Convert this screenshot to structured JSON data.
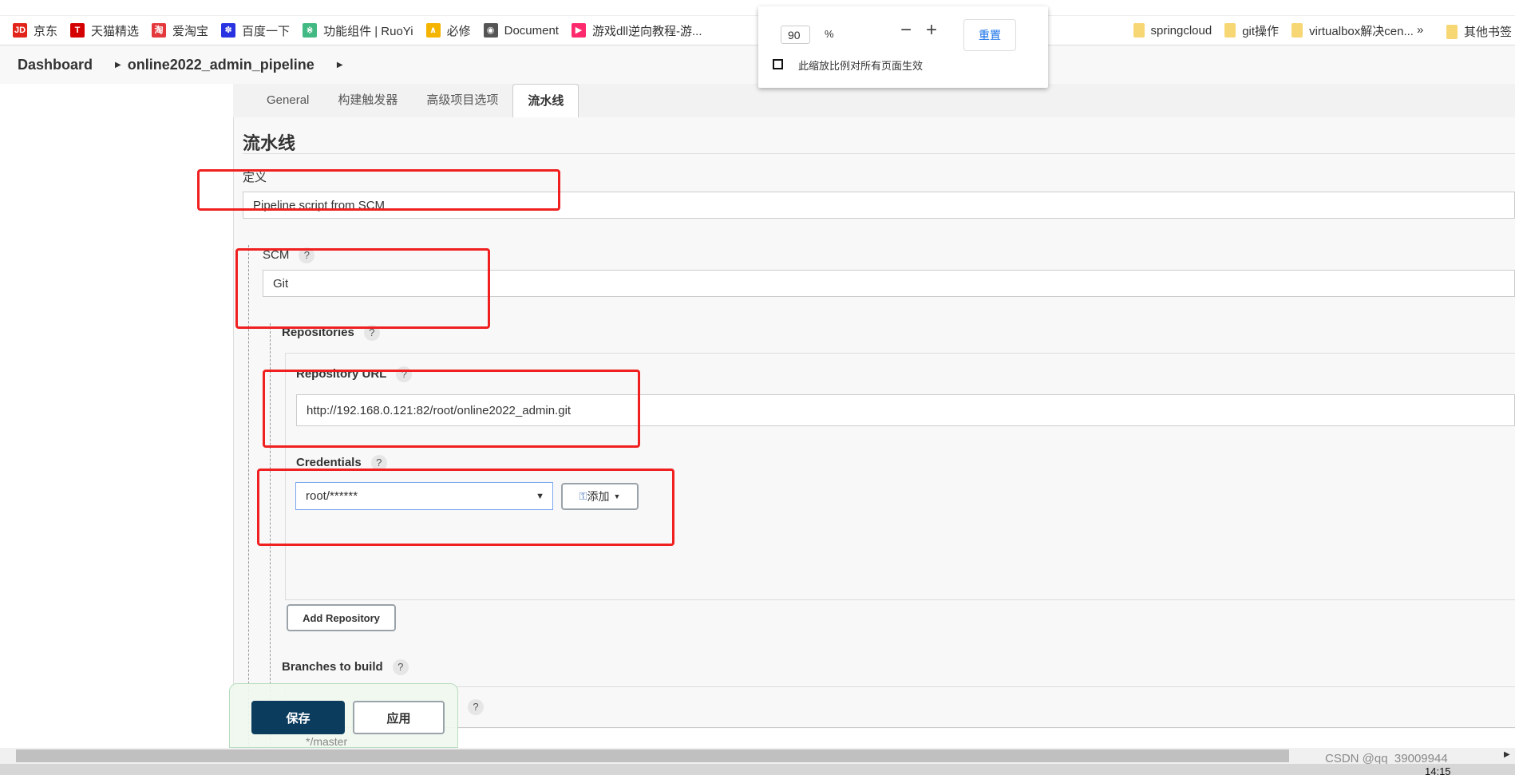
{
  "bookmarks": [
    {
      "label": "京东",
      "icon": "jd-icon",
      "color": "#e1251b",
      "glyph": "JD"
    },
    {
      "label": "天猫精选",
      "icon": "tmall-icon",
      "color": "#d40000",
      "glyph": "T"
    },
    {
      "label": "爱淘宝",
      "icon": "taobao-icon",
      "color": "#e4393c",
      "glyph": "淘"
    },
    {
      "label": "百度一下",
      "icon": "baidu-icon",
      "color": "#2932e1",
      "glyph": "✽"
    },
    {
      "label": "功能组件 | RuoYi",
      "icon": "ruoyi-icon",
      "color": "#42b983",
      "glyph": "⋇"
    },
    {
      "label": "必修",
      "icon": "bixiu-icon",
      "color": "#f5b400",
      "glyph": "∧"
    },
    {
      "label": "Document",
      "icon": "globe-icon",
      "color": "#555555",
      "glyph": "◉"
    },
    {
      "label": "游戏dll逆向教程-游...",
      "icon": "youku-icon",
      "color": "#ff2a6d",
      "glyph": "▶"
    },
    {
      "label": "springcloud",
      "icon": "folder-icon",
      "color": "#f7d774",
      "glyph": ""
    },
    {
      "label": "git操作",
      "icon": "folder-icon",
      "color": "#f7d774",
      "glyph": ""
    },
    {
      "label": "virtualbox解决cen...",
      "icon": "folder-icon",
      "color": "#f7d774",
      "glyph": ""
    }
  ],
  "bookmarks_more": "»",
  "other_bookmarks": "其他书签",
  "breadcrumb": [
    "Dashboard",
    "online2022_admin_pipeline"
  ],
  "zoom_popup": {
    "value": "90",
    "unit": "%",
    "minus": "−",
    "plus": "+",
    "reset": "重置",
    "apply_all_label": "此缩放比例对所有页面生效",
    "apply_all_checked": false
  },
  "tabs": [
    {
      "label": "General"
    },
    {
      "label": "构建触发器"
    },
    {
      "label": "高级项目选项"
    },
    {
      "label": "流水线",
      "active": true
    }
  ],
  "section_title": "流水线",
  "definition": {
    "label": "定义",
    "value": "Pipeline script from SCM"
  },
  "scm": {
    "label": "SCM",
    "help": "?",
    "value": "Git"
  },
  "repositories": {
    "label": "Repositories",
    "help": "?"
  },
  "repo_url": {
    "label": "Repository URL",
    "help": "?",
    "value": "http://192.168.0.121:82/root/online2022_admin.git"
  },
  "credentials": {
    "label": "Credentials",
    "help": "?",
    "value": "root/******",
    "add_label": "添加"
  },
  "add_repository": "Add Repository",
  "branches": {
    "label": "Branches to build",
    "help": "?",
    "value": "*/master"
  },
  "buttons": {
    "save": "保存",
    "apply": "应用"
  },
  "watermark": "CSDN @qq_39009944",
  "clock": "14:15",
  "colors": {
    "save_button": "#0b3c5d",
    "highlight": "#f02020",
    "link": "#1a73e8"
  }
}
